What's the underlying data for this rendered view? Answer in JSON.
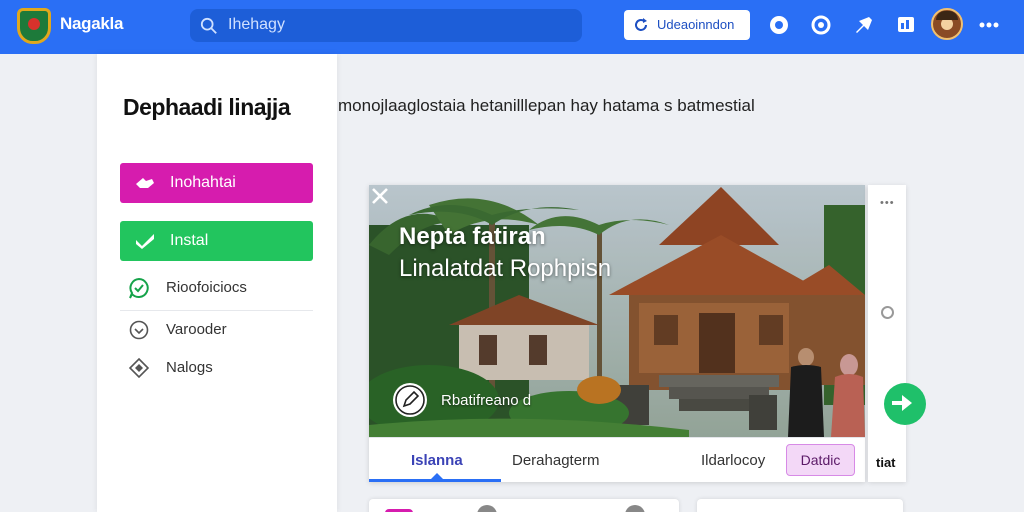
{
  "header": {
    "brand": "Nagakla",
    "search_placeholder": "Ihehagy",
    "action_button": "Udeaoinndon",
    "nav_icons": [
      "circle-dot-icon",
      "refresh-icon",
      "pin-icon",
      "chart-icon"
    ],
    "more_icon": "kebab-menu-icon"
  },
  "sidebar": {
    "title": "Dephaadi linajja",
    "buttons": [
      {
        "label": "Inohahtai",
        "color": "#d61cae",
        "icon": "hand-icon"
      },
      {
        "label": "Instal",
        "color": "#22c55e",
        "icon": "check-icon"
      }
    ],
    "items": [
      {
        "label": "Rioofoiciocs",
        "icon": "chat-check-icon"
      },
      {
        "label": "Varooder",
        "icon": "chevron-circle-icon"
      },
      {
        "label": "Nalogs",
        "icon": "diamond-icon"
      }
    ]
  },
  "main": {
    "subtitle": "monojlaaglostaia hetanilllepan hay hatama s batmestial",
    "card": {
      "hero_title": "Nepta fatiran",
      "hero_subtitle": "Linalatdat Rophpisn",
      "chip_label": "Rbatifreano d",
      "tabs": [
        {
          "label": "Islanna",
          "active": true
        },
        {
          "label": "Derahagterm",
          "active": false
        },
        {
          "label": "Ildarlocoy",
          "active": false
        }
      ],
      "tab_button": "Datdic"
    },
    "right_panel": {
      "dots": "•••",
      "label": "tiat"
    }
  }
}
